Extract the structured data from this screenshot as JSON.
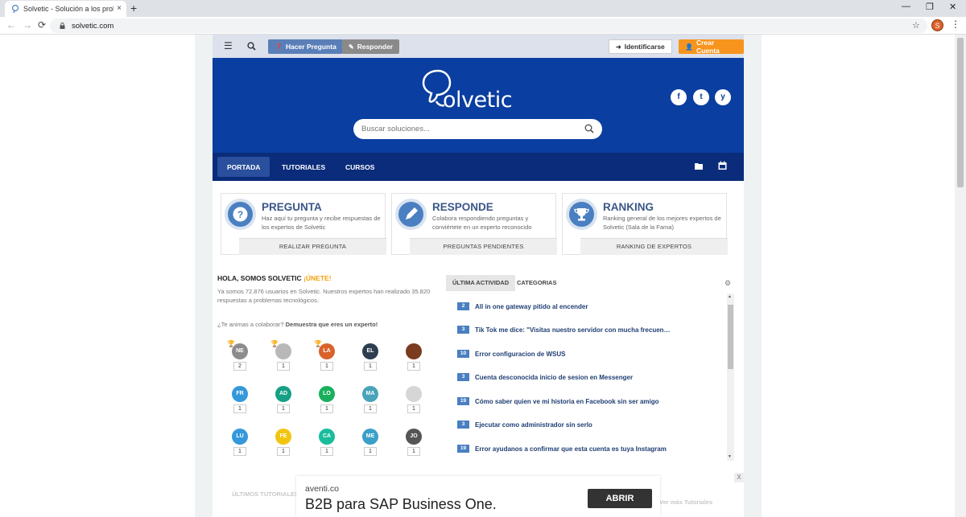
{
  "browser": {
    "tab_title": "Solvetic - Solución a los problemas",
    "tab_close": "×",
    "new_tab": "+",
    "url": "solvetic.com",
    "profile_initial": "S",
    "win_min": "—",
    "win_restore": "❐",
    "win_close": "✕"
  },
  "site": {
    "topbar": {
      "ask_label": "Hacer Pregunta",
      "answer_label": "Responder",
      "login_label": "Identificarse",
      "signup_label": "Crear Cuenta"
    },
    "hero": {
      "logo_text": "olvetic",
      "search_placeholder": "Buscar soluciones...",
      "social": [
        "f",
        "t",
        "y"
      ]
    },
    "nav": {
      "items": [
        "PORTADA",
        "TUTORIALES",
        "CURSOS"
      ]
    },
    "cards": [
      {
        "title": "PREGUNTA",
        "text": "Haz aquí tu pregunta y recibe respuestas de los expertos de Solvetic",
        "button": "REALIZAR PREGUNTA",
        "icon": "question-icon"
      },
      {
        "title": "RESPONDE",
        "text": "Colabora respondiendo preguntas y conviértete en un experto reconocido",
        "button": "PREGUNTAS PENDIENTES",
        "icon": "pencil-icon"
      },
      {
        "title": "RANKING",
        "text": "Ranking general de los mejores expertos de Solvetic (Sala de la Fama)",
        "button": "RANKING DE EXPERTOS",
        "icon": "trophy-icon"
      }
    ],
    "welcome": {
      "heading": "HOLA, SOMOS SOLVETIC",
      "join": "¡ÚNETE!",
      "intro": "Ya somos 72.876 usuarios en Solvetic. Nuestros expertos han realizado 35.820 respuestas a problemas tecnológicos.",
      "ask_prefix": "¿Te animas a colaborar?",
      "ask_link": "Demuestra que eres un experto!"
    },
    "users": [
      {
        "initials": "NE",
        "count": "2",
        "color": "#8c8c8c",
        "trophy": "gold"
      },
      {
        "initials": "",
        "count": "1",
        "color": "#b8b8b8",
        "trophy": "silver"
      },
      {
        "initials": "LA",
        "count": "1",
        "color": "#d9622b",
        "trophy": "gold"
      },
      {
        "initials": "EL",
        "count": "1",
        "color": "#2c3e50",
        "trophy": ""
      },
      {
        "initials": "",
        "count": "1",
        "color": "#7a3b1e",
        "trophy": ""
      },
      {
        "initials": "FR",
        "count": "1",
        "color": "#3498db",
        "trophy": ""
      },
      {
        "initials": "AD",
        "count": "1",
        "color": "#16a085",
        "trophy": ""
      },
      {
        "initials": "LO",
        "count": "1",
        "color": "#1aaf5d",
        "trophy": ""
      },
      {
        "initials": "MA",
        "count": "1",
        "color": "#4aa3b8",
        "trophy": ""
      },
      {
        "initials": "",
        "count": "1",
        "color": "#d6d6d6",
        "trophy": ""
      },
      {
        "initials": "LU",
        "count": "1",
        "color": "#3498db",
        "trophy": ""
      },
      {
        "initials": "FE",
        "count": "1",
        "color": "#f1c40f",
        "trophy": ""
      },
      {
        "initials": "CA",
        "count": "1",
        "color": "#1abc9c",
        "trophy": ""
      },
      {
        "initials": "ME",
        "count": "1",
        "color": "#3aa0c8",
        "trophy": ""
      },
      {
        "initials": "JO",
        "count": "1",
        "color": "#555555",
        "trophy": ""
      }
    ],
    "activity_tabs": [
      "ÚLTIMA ACTIVIDAD",
      "CATEGORIAS"
    ],
    "activity": [
      {
        "count": "2",
        "title": "All in one gateway pitido al encender"
      },
      {
        "count": "3",
        "title": "Tik Tok me dice: \"Visitas nuestro servidor con mucha frecuen…"
      },
      {
        "count": "10",
        "title": "Error configuracion de WSUS"
      },
      {
        "count": "3",
        "title": "Cuenta desconocida inicio de sesion en Messenger"
      },
      {
        "count": "19",
        "title": "Cómo saber quien ve mi historia en Facebook sin ser amigo"
      },
      {
        "count": "3",
        "title": "Ejecutar como administrador sin serlo"
      },
      {
        "count": "19",
        "title": "Error ayudanos a confirmar que esta cuenta es tuya Instagram"
      }
    ],
    "footer": {
      "latest": "ÚLTIMOS TUTORIALES",
      "more": "Ver más Tutoriales"
    }
  },
  "ad": {
    "domain": "aventi.co",
    "headline": "B2B para SAP Business One.",
    "cta": "ABRIR",
    "close": "X"
  },
  "colors": {
    "hero_blue": "#0a3ea0",
    "nav_blue": "#0a2c7a",
    "accent_orange": "#f7941d",
    "card_title": "#3a5687"
  }
}
